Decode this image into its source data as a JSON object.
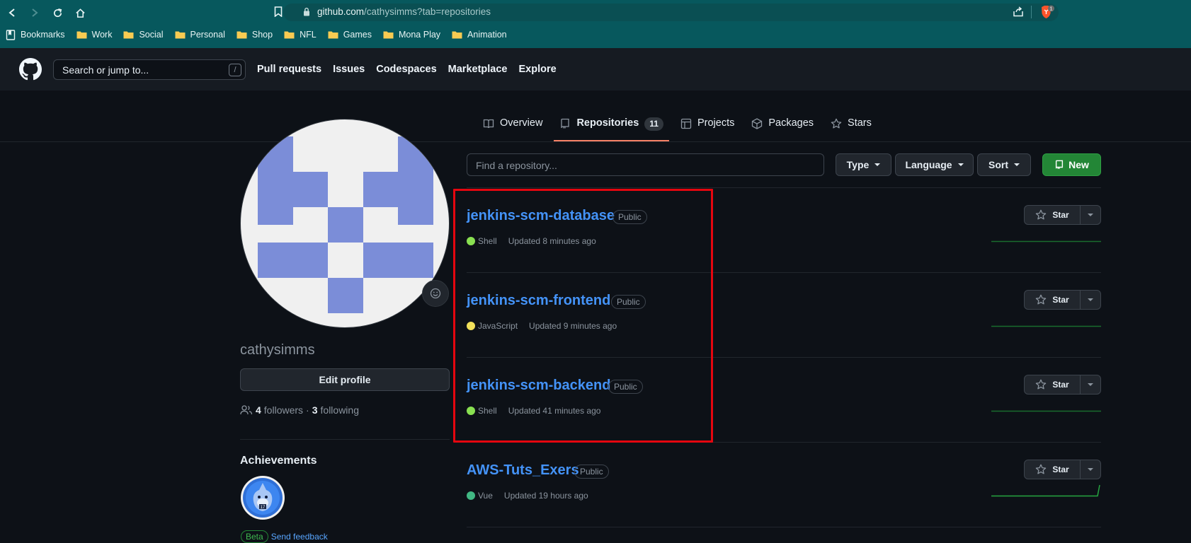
{
  "browser": {
    "url_host": "github.com",
    "url_path": "/cathysimms?tab=repositories",
    "bookmarks": [
      "Bookmarks",
      "Work",
      "Social",
      "Personal",
      "Shop",
      "NFL",
      "Games",
      "Mona Play",
      "Animation"
    ],
    "brave_badge": "1"
  },
  "header": {
    "search_placeholder": "Search or jump to...",
    "search_shortcut": "/",
    "nav": [
      "Pull requests",
      "Issues",
      "Codespaces",
      "Marketplace",
      "Explore"
    ]
  },
  "tabs": [
    {
      "label": "Overview",
      "icon": "book-icon"
    },
    {
      "label": "Repositories",
      "icon": "repo-icon",
      "count": "11",
      "active": true
    },
    {
      "label": "Projects",
      "icon": "table-icon"
    },
    {
      "label": "Packages",
      "icon": "package-icon"
    },
    {
      "label": "Stars",
      "icon": "star-icon"
    }
  ],
  "profile": {
    "username": "cathysimms",
    "edit_label": "Edit profile",
    "followers_count": "4",
    "followers_label": "followers",
    "separator": "·",
    "following_count": "3",
    "following_label": "following",
    "achievements_title": "Achievements",
    "beta_label": "Beta",
    "feedback_label": "Send feedback"
  },
  "filter": {
    "find_placeholder": "Find a repository...",
    "type_label": "Type",
    "language_label": "Language",
    "sort_label": "Sort",
    "new_label": "New"
  },
  "repos": [
    {
      "name": "jenkins-scm-database",
      "visibility": "Public",
      "language": "Shell",
      "updated": "Updated 8 minutes ago",
      "star_label": "Star"
    },
    {
      "name": "jenkins-scm-frontend",
      "visibility": "Public",
      "language": "JavaScript",
      "updated": "Updated 9 minutes ago",
      "star_label": "Star"
    },
    {
      "name": "jenkins-scm-backend",
      "visibility": "Public",
      "language": "Shell",
      "updated": "Updated 41 minutes ago",
      "star_label": "Star"
    },
    {
      "name": "AWS-Tuts_Exers",
      "visibility": "Public",
      "language": "Vue",
      "updated": "Updated 19 hours ago",
      "star_label": "Star"
    }
  ],
  "colors": {
    "accent_link": "#4493f8",
    "tab_underline": "#f78166",
    "new_button": "#238636",
    "highlight_box": "#e5060f",
    "lang_shell": "#89e051",
    "lang_javascript": "#f1e05a",
    "lang_vue": "#41b883",
    "browser_chrome": "#07585d"
  }
}
